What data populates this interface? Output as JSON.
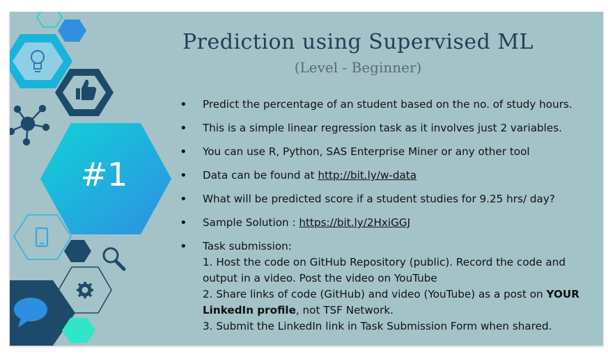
{
  "slide": {
    "title": "Prediction using Supervised ML",
    "subtitle": "(Level - Beginner)",
    "badge": "#1",
    "bullets": [
      {
        "text": "Predict the percentage of an student based on the no. of study hours."
      },
      {
        "text": "This is a simple linear  regression task as it involves just 2 variables."
      },
      {
        "text": "You can use R, Python, SAS Enterprise Miner or any other tool"
      },
      {
        "prefix": "Data can be found at ",
        "link": "http://bit.ly/w-data"
      },
      {
        "text": "What will be predicted score if a student studies for 9.25 hrs/ day?"
      },
      {
        "prefix": "Sample Solution : ",
        "link": "https://bit.ly/2HxiGGJ"
      }
    ],
    "task": {
      "heading": "Task submission:",
      "line1": "1. Host the code on GitHub Repository (public). Record the code and output in a video. Post the video on YouTube",
      "line2_pre": "2. Share links of code (GitHub) and video (YouTube) as a post on ",
      "line2_bold": "YOUR LinkedIn profile",
      "line2_post": ", not TSF Network.",
      "line3": "3. Submit the LinkedIn link in Task Submission Form when shared."
    }
  },
  "colors": {
    "background": "#a3c3c8",
    "navy": "#1e4a6a",
    "teal": "#14c8d6",
    "blue": "#2e8fe0",
    "mint": "#2ee6c8"
  },
  "icons": [
    "lightbulb-icon",
    "thumbs-up-icon",
    "network-icon",
    "phone-icon",
    "magnifier-icon",
    "gear-icon",
    "chat-bubble-icon"
  ]
}
